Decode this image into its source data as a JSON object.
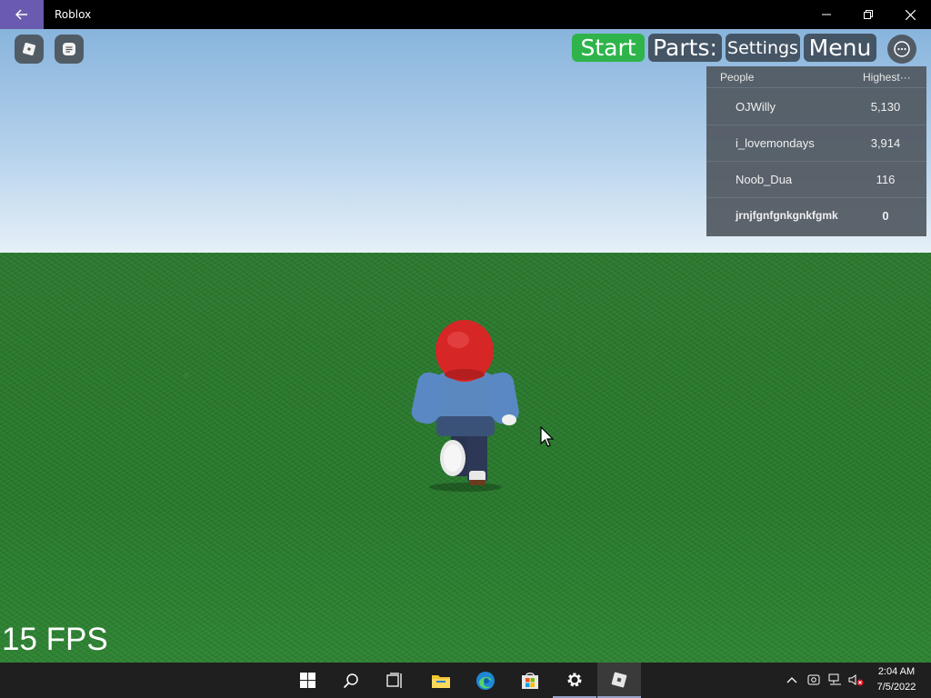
{
  "window": {
    "title": "Roblox"
  },
  "hud": {
    "start_label": "Start",
    "parts_label": "Parts:",
    "settings_label": "Settings",
    "menu_label": "Menu"
  },
  "leaderboard": {
    "header_people": "People",
    "header_stat": "Highest···",
    "rows": [
      {
        "name": "OJWilly",
        "value": "5,130"
      },
      {
        "name": "i_lovemondays",
        "value": "3,914"
      },
      {
        "name": "Noob_Dua",
        "value": "116"
      },
      {
        "name": "jrnjfgnfgnkgnkfgmk",
        "value": "0"
      }
    ]
  },
  "fps_text": "15 FPS",
  "colors": {
    "sky": "#b5d2ec",
    "grass": "#2c7a30",
    "start_button": "#2fb44b",
    "back_button": "#6b5bb0"
  },
  "taskbar": {
    "icons": [
      "windows-start-icon",
      "search-icon",
      "task-view-icon",
      "file-explorer-icon",
      "edge-icon",
      "store-icon",
      "settings-icon",
      "roblox-icon"
    ],
    "time": "2:04 AM",
    "date": "7/5/2022"
  }
}
